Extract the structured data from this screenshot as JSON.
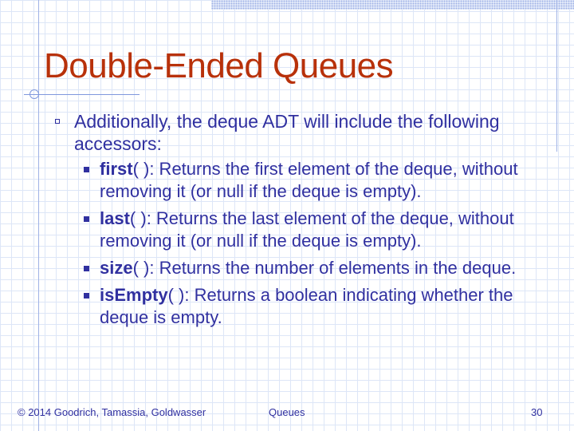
{
  "slide": {
    "title": "Double-Ended Queues",
    "main_bullet": "Additionally, the deque ADT will include the following accessors:",
    "sub_bullets": [
      {
        "method": "first",
        "parens": "( )",
        "description": ": Returns the first element of the deque, without removing it (or null if the deque is empty)."
      },
      {
        "method": "last",
        "parens": "( )",
        "description": ": Returns the last element of the deque, without removing it (or null if the deque is empty)."
      },
      {
        "method": "size",
        "parens": "( )",
        "description": ": Returns the number of elements in the deque."
      },
      {
        "method": "isEmpty",
        "parens": "( )",
        "description": ": Returns a boolean indicating whether the deque is empty."
      }
    ]
  },
  "footer": {
    "copyright": "© 2014 Goodrich, Tamassia, Goldwasser",
    "topic": "Queues",
    "page_number": "30"
  },
  "colors": {
    "title": "#b8310a",
    "text": "#3030a0",
    "grid": "#dde6f7",
    "accent_line": "#7f98dd"
  }
}
